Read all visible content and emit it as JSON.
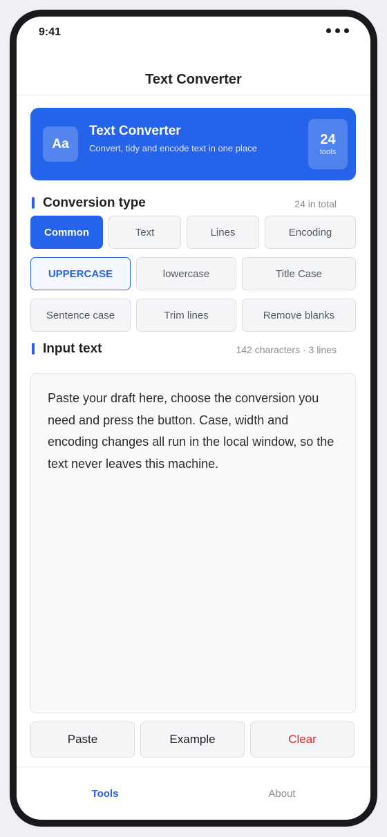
{
  "status_bar": {
    "time": "9:41"
  },
  "nav": {
    "title": "Text Converter"
  },
  "banner": {
    "logo": "Aa",
    "title": "Text Converter",
    "subtitle": "Convert, tidy and encode text in one place",
    "count": "24",
    "count_unit": "tools",
    "color": "#2563eb"
  },
  "conversion": {
    "title": "Conversion type",
    "meta": "24 in total",
    "categories": [
      {
        "label": "Common",
        "active": true
      },
      {
        "label": "Text",
        "active": false
      },
      {
        "label": "Lines",
        "active": false
      },
      {
        "label": "Encoding",
        "active": false
      }
    ],
    "options": [
      {
        "label": "UPPERCASE",
        "selected": true
      },
      {
        "label": "lowercase",
        "selected": false
      },
      {
        "label": "Title Case",
        "selected": false
      },
      {
        "label": "Sentence case",
        "selected": false
      },
      {
        "label": "Trim lines",
        "selected": false
      },
      {
        "label": "Remove blanks",
        "selected": false
      }
    ]
  },
  "input": {
    "title": "Input text",
    "meta": "142 characters · 3 lines",
    "value": "Paste your draft here, choose the conversion you need and press the button. Case, width and encoding changes all run in the local window, so the text never leaves this machine."
  },
  "actions": {
    "paste": "Paste",
    "example": "Example",
    "clear": "Clear",
    "danger_color": "#dc2626"
  },
  "tabs": [
    {
      "label": "Tools",
      "active": true
    },
    {
      "label": "About",
      "active": false
    }
  ]
}
